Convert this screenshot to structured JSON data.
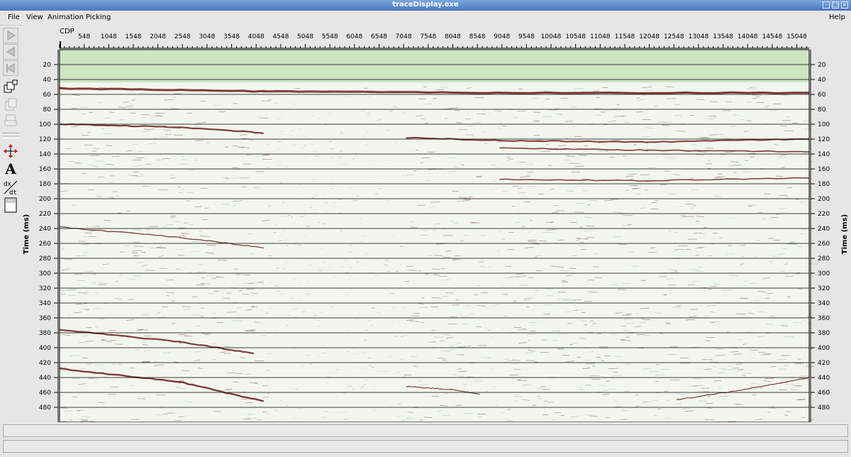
{
  "window": {
    "title": "traceDisplay.exe"
  },
  "menu": {
    "file": "File",
    "view": "View",
    "animation": "Animation",
    "picking": "Picking",
    "help": "Help"
  },
  "toolbar": {
    "buttons": [
      "play-forward-icon",
      "step-back-icon",
      "step-first-icon",
      "window-switch-icon",
      "copy-icon",
      "print-icon",
      "zoom-pan-icon",
      "text-annotation-icon",
      "dx-dt-icon",
      "panel-icon"
    ]
  },
  "plot": {
    "x_axis_label": "CDP",
    "y_axis_label": "Time (ms)",
    "colors": {
      "background": "#f1f7ee",
      "water_band": "#cde6c2",
      "wiggle": "#6e1a1a"
    }
  },
  "chart_data": {
    "type": "heatmap",
    "title": "",
    "xlabel": "CDP",
    "ylabel": "Time (ms)",
    "xlim": [
      48,
      15300
    ],
    "ylim": [
      0,
      500
    ],
    "x_ticks": [
      48,
      548,
      1048,
      1548,
      2048,
      2548,
      3048,
      3548,
      4048,
      4548,
      5048,
      5548,
      6048,
      6548,
      7048,
      7548,
      8048,
      8548,
      9048,
      9548,
      10048,
      10548,
      11048,
      11548,
      12048,
      12548,
      13048,
      13548,
      14048,
      14548,
      15048
    ],
    "x_tick_labels": [
      "",
      "548",
      "1048",
      "1548",
      "2048",
      "2548",
      "3048",
      "3548",
      "4048",
      "4548",
      "5048",
      "5548",
      "6048",
      "6548",
      "7048",
      "7548",
      "8048",
      "8548",
      "9048",
      "9548",
      "10048",
      "10548",
      "11048",
      "11548",
      "12048",
      "12548",
      "13048",
      "13548",
      "14048",
      "14548",
      "15048"
    ],
    "y_ticks": [
      20,
      40,
      60,
      80,
      100,
      120,
      140,
      160,
      180,
      200,
      220,
      240,
      260,
      280,
      300,
      320,
      340,
      360,
      380,
      400,
      420,
      440,
      460,
      480
    ],
    "grid": true,
    "seafloor_ms": 50,
    "reflectors": [
      {
        "ms": [
          52,
          56,
          58,
          58
        ],
        "cdp": [
          48,
          4200,
          9000,
          15300
        ],
        "strength": 3.0
      },
      {
        "ms": [
          100,
          104,
          112
        ],
        "cdp": [
          48,
          2500,
          4200
        ],
        "strength": 2.2
      },
      {
        "ms": [
          118,
          122,
          124,
          120
        ],
        "cdp": [
          7100,
          9000,
          12000,
          15300
        ],
        "strength": 2.0
      },
      {
        "ms": [
          132,
          135,
          137
        ],
        "cdp": [
          9000,
          12000,
          15300
        ],
        "strength": 1.6
      },
      {
        "ms": [
          174,
          176,
          172
        ],
        "cdp": [
          9000,
          12000,
          15300
        ],
        "strength": 1.5
      },
      {
        "ms": [
          238,
          252,
          266
        ],
        "cdp": [
          48,
          2500,
          4200
        ],
        "strength": 1.3
      },
      {
        "ms": [
          376,
          392,
          408
        ],
        "cdp": [
          48,
          2500,
          4000
        ],
        "strength": 2.2
      },
      {
        "ms": [
          428,
          446,
          472
        ],
        "cdp": [
          48,
          2500,
          4200
        ],
        "strength": 2.4
      },
      {
        "ms": [
          452,
          456,
          462
        ],
        "cdp": [
          7100,
          8000,
          8600
        ],
        "strength": 1.2
      },
      {
        "ms": [
          470,
          456,
          440
        ],
        "cdp": [
          12600,
          14000,
          15300
        ],
        "strength": 1.2
      }
    ],
    "weak_zones": [
      {
        "cdp": [
          4200,
          7050
        ],
        "ms": [
          60,
          500
        ]
      },
      {
        "cdp": [
          8650,
          9050
        ],
        "ms": [
          60,
          500
        ]
      }
    ]
  }
}
